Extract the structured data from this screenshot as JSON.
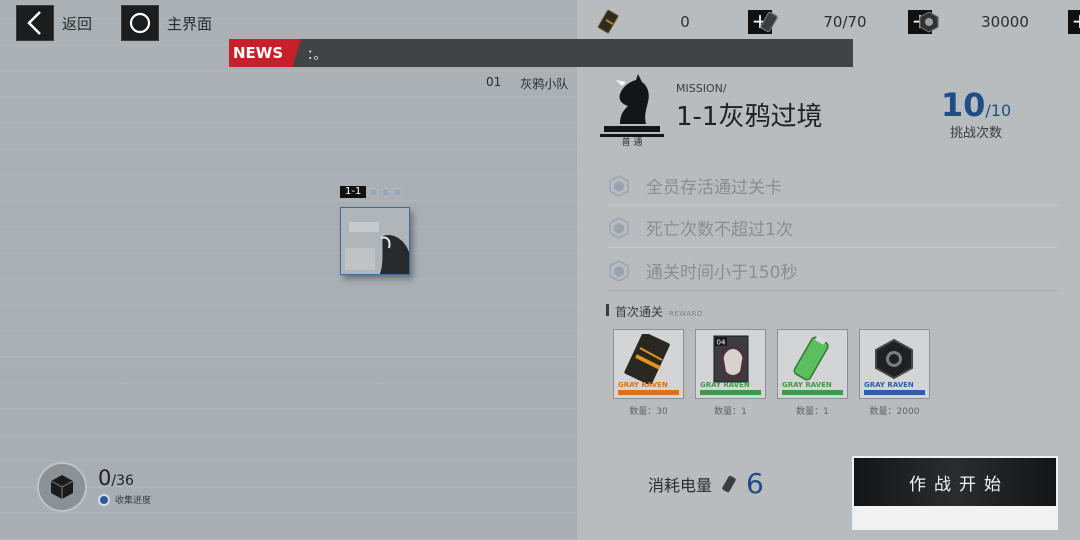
{
  "nav": {
    "back_label": "返回",
    "home_label": "主界面"
  },
  "resources": [
    {
      "icon": "ticket-icon",
      "value": "0"
    },
    {
      "icon": "battery-icon",
      "value": "70/70"
    },
    {
      "icon": "nut-icon",
      "value": "30000"
    }
  ],
  "plus_label": "+",
  "news": {
    "tag": "NEWS",
    "text": "：。"
  },
  "squad": {
    "number": "01",
    "name": "灰鸦小队"
  },
  "stage": {
    "id": "1-1",
    "stars": 0,
    "stars_max": 3
  },
  "mission": {
    "label": "MISSION/",
    "title": "1-1灰鸦过境",
    "difficulty": "普 通",
    "attempts_current": "10",
    "attempts_max": "/10",
    "attempts_label": "挑战次数"
  },
  "objectives": [
    "全员存活通过关卡",
    "死亡次数不超过1次",
    "通关时间小于150秒"
  ],
  "rewards_header": {
    "title": "首次通关",
    "subtitle": "REWARD"
  },
  "rewards": [
    {
      "brand": "GRAY RAVEN",
      "quantity": "数量：30",
      "rarity_color": "#d9721b"
    },
    {
      "brand": "GRAY RAVEN",
      "quantity": "数量：1",
      "rarity_color": "#3e9a46"
    },
    {
      "brand": "GRAY RAVEN",
      "quantity": "数量：1",
      "rarity_color": "#3e9a46"
    },
    {
      "brand": "GRAY RAVEN",
      "quantity": "数量：2000",
      "rarity_color": "#2d5fa8"
    }
  ],
  "cost": {
    "label": "消耗电量",
    "value": "6"
  },
  "start_button": {
    "label": "作战开始"
  },
  "collection": {
    "count": "0",
    "total": "/36",
    "label": "收集进度"
  },
  "colors": {
    "accent_blue": "#1d4f86",
    "news_red": "#c8202a"
  }
}
